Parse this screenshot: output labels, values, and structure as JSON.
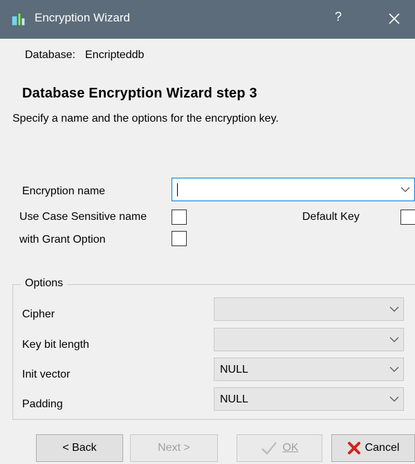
{
  "window": {
    "title": "Encryption Wizard",
    "help_glyph": "?",
    "close_glyph": "✕",
    "app_icon": "wizard-app-icon"
  },
  "database": {
    "label": "Database:",
    "value": "Encripteddb"
  },
  "heading": "Database Encryption Wizard step 3",
  "subtitle": "Specify a name and the options for the encryption key.",
  "form": {
    "encryption_name_label": "Encryption name",
    "encryption_name_value": "",
    "case_sensitive_label": "Use Case Sensitive name",
    "case_sensitive_checked": false,
    "default_key_label": "Default Key",
    "default_key_checked": false,
    "grant_option_label": "with Grant Option",
    "grant_option_checked": false
  },
  "options": {
    "title": "Options",
    "cipher_label": "Cipher",
    "cipher_value": "",
    "key_bit_length_label": "Key bit length",
    "key_bit_length_value": "",
    "init_vector_label": "Init vector",
    "init_vector_value": "NULL",
    "padding_label": "Padding",
    "padding_value": "NULL"
  },
  "buttons": {
    "back": "< Back",
    "next": "Next >",
    "ok": "OK",
    "cancel": "Cancel"
  },
  "colors": {
    "titlebar": "#5d6c7b",
    "cancel_icon": "#d0241c",
    "focus_border": "#0078d7"
  }
}
